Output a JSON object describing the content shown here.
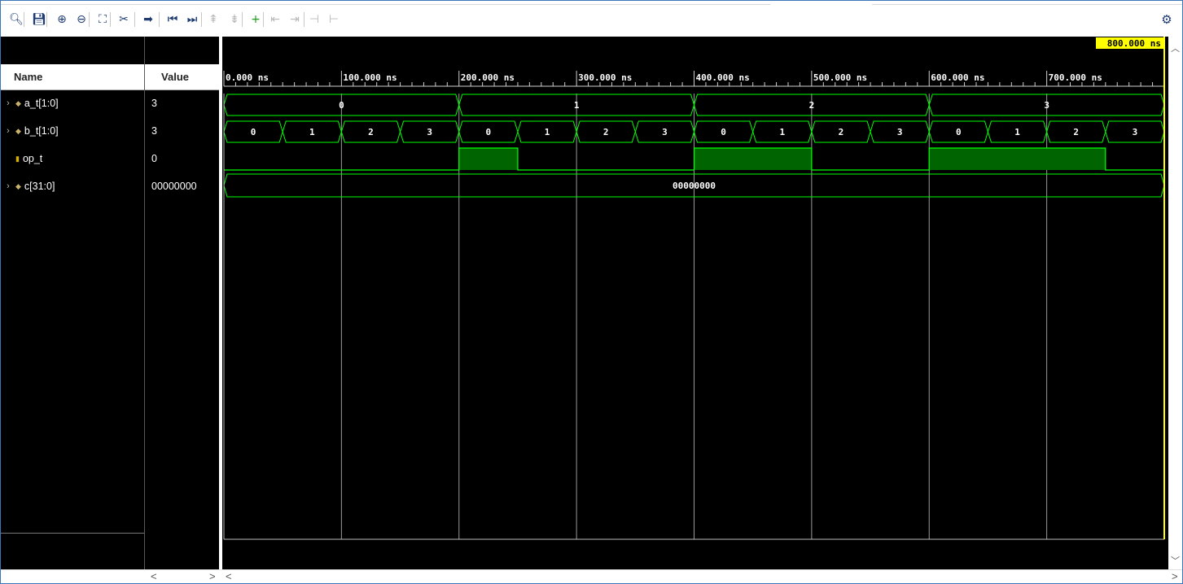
{
  "toolbar": {
    "buttons": [
      {
        "icon": "search-icon",
        "glyph": "🔍︎",
        "state": "normal"
      },
      {
        "icon": "save-icon",
        "glyph": "💾︎",
        "state": "normal"
      },
      {
        "icon": "zoom-in-icon",
        "glyph": "⊕",
        "state": "normal"
      },
      {
        "icon": "zoom-out-icon",
        "glyph": "⊖",
        "state": "normal"
      },
      {
        "icon": "zoom-fit-icon",
        "glyph": "⛶",
        "state": "normal"
      },
      {
        "icon": "cursor-swap-icon",
        "glyph": "✂",
        "state": "normal"
      },
      {
        "icon": "go-to-cursor-icon",
        "glyph": "➡",
        "state": "normal"
      },
      {
        "icon": "go-to-start-icon",
        "glyph": "⏮",
        "state": "normal"
      },
      {
        "icon": "go-to-end-icon",
        "glyph": "⏭",
        "state": "normal"
      },
      {
        "icon": "previous-transition-icon",
        "glyph": "⇞",
        "state": "disabled"
      },
      {
        "icon": "next-transition-icon",
        "glyph": "⇟",
        "state": "disabled"
      },
      {
        "icon": "add-marker-icon",
        "glyph": "+",
        "state": "green"
      },
      {
        "icon": "previous-marker-icon",
        "glyph": "⇤",
        "state": "disabled"
      },
      {
        "icon": "next-marker-icon",
        "glyph": "⇥",
        "state": "disabled"
      },
      {
        "icon": "swap-cursors-icon",
        "glyph": "⊣",
        "state": "disabled"
      },
      {
        "icon": "snap-icon",
        "glyph": "⊢",
        "state": "disabled"
      }
    ],
    "settings_icon": "⚙"
  },
  "panel": {
    "name_header": "Name",
    "value_header": "Value"
  },
  "signals": [
    {
      "name": "a_t[1:0]",
      "value": "3",
      "type": "bus",
      "expandable": true
    },
    {
      "name": "b_t[1:0]",
      "value": "3",
      "type": "bus",
      "expandable": true
    },
    {
      "name": "op_t",
      "value": "0",
      "type": "bit",
      "expandable": false
    },
    {
      "name": "c[31:0]",
      "value": "00000000",
      "type": "bus",
      "expandable": true
    }
  ],
  "cursor_label": "800.000 ns",
  "timeline": {
    "ticks": [
      "0.000 ns",
      "100.000 ns",
      "200.000 ns",
      "300.000 ns",
      "400.000 ns",
      "500.000 ns",
      "600.000 ns",
      "700.000 ns"
    ]
  },
  "waveform_data": {
    "time_range_ns": [
      0,
      800
    ],
    "cursor_ns": 800,
    "a_t": [
      {
        "from": 0,
        "to": 200,
        "value": "0"
      },
      {
        "from": 200,
        "to": 400,
        "value": "1"
      },
      {
        "from": 400,
        "to": 600,
        "value": "2"
      },
      {
        "from": 600,
        "to": 800,
        "value": "3"
      }
    ],
    "b_t": [
      {
        "from": 0,
        "to": 50,
        "value": "0"
      },
      {
        "from": 50,
        "to": 100,
        "value": "1"
      },
      {
        "from": 100,
        "to": 150,
        "value": "2"
      },
      {
        "from": 150,
        "to": 200,
        "value": "3"
      },
      {
        "from": 200,
        "to": 250,
        "value": "0"
      },
      {
        "from": 250,
        "to": 300,
        "value": "1"
      },
      {
        "from": 300,
        "to": 350,
        "value": "2"
      },
      {
        "from": 350,
        "to": 400,
        "value": "3"
      },
      {
        "from": 400,
        "to": 450,
        "value": "0"
      },
      {
        "from": 450,
        "to": 500,
        "value": "1"
      },
      {
        "from": 500,
        "to": 550,
        "value": "2"
      },
      {
        "from": 550,
        "to": 600,
        "value": "3"
      },
      {
        "from": 600,
        "to": 650,
        "value": "0"
      },
      {
        "from": 650,
        "to": 700,
        "value": "1"
      },
      {
        "from": 700,
        "to": 750,
        "value": "2"
      },
      {
        "from": 750,
        "to": 800,
        "value": "3"
      }
    ],
    "op_t_high": [
      {
        "from": 200,
        "to": 250
      },
      {
        "from": 400,
        "to": 500
      },
      {
        "from": 600,
        "to": 750
      }
    ],
    "c": [
      {
        "from": 0,
        "to": 800,
        "value": "00000000"
      }
    ]
  },
  "colors": {
    "wave": "#00ff00",
    "fill": "#006400",
    "cursor_label_bg": "#ffff00"
  }
}
